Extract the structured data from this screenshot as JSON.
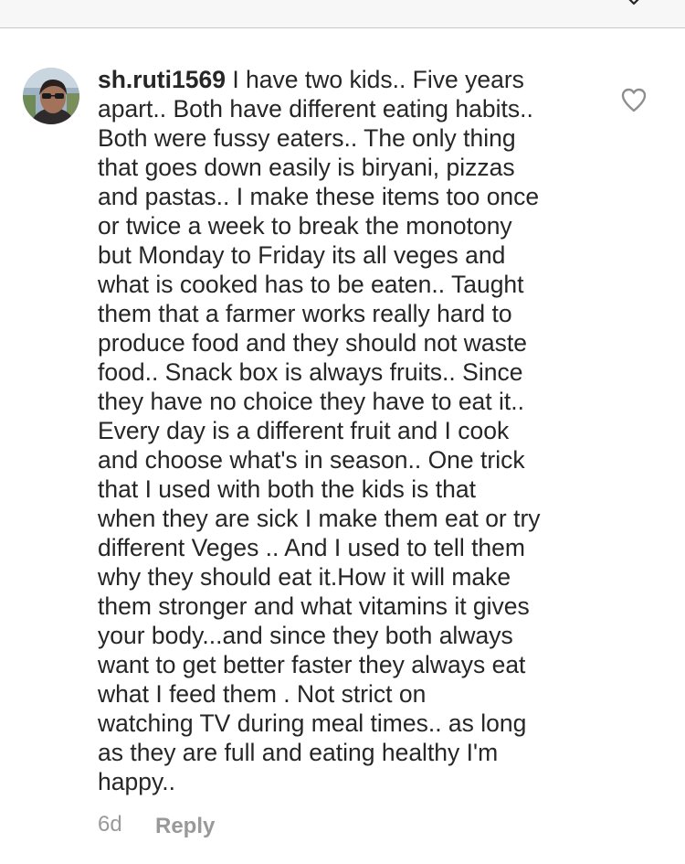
{
  "comment": {
    "username": "sh.ruti1569",
    "text": "I have two kids.. Five years\napart.. Both have different eating habits..\nBoth were fussy eaters.. The only thing\nthat goes down easily is biryani, pizzas\nand pastas.. I make these items too once\nor twice a week  to break the monotony\nbut Monday to Friday its all veges and\nwhat is cooked has to be eaten.. Taught\nthem that a farmer works really hard to\nproduce food and they should not waste\nfood.. Snack box is always fruits.. Since\nthey have no choice they have to eat it..\nEvery day is a different fruit and I cook\nand choose what's in season.. One trick\nthat I used with both the kids is that\nwhen they are sick I make them eat or try\ndifferent Veges .. And I used to tell them\nwhy they should eat it.How it will make\nthem stronger and what vitamins it gives\nyour body...and since they both always\nwant to get better faster they always eat\nwhat I feed them .  Not strict on\nwatching TV during meal times.. as long\nas they are full and eating healthy I'm\nhappy..",
    "time": "6d",
    "reply_label": "Reply"
  },
  "icons": {
    "like": "heart-outline-icon",
    "top": "chevron-down-icon"
  },
  "colors": {
    "text": "#262626",
    "meta": "#999999",
    "icon": "#8e8e8e"
  }
}
